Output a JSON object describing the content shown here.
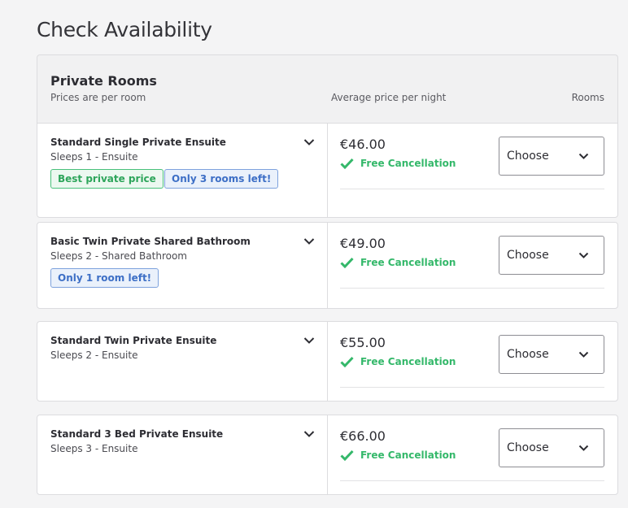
{
  "page": {
    "title": "Check Availability"
  },
  "header": {
    "title": "Private Rooms",
    "subtitle": "Prices are per room",
    "price_label": "Average price per night",
    "rooms_label": "Rooms"
  },
  "rooms": [
    {
      "name": "Standard Single Private Ensuite",
      "sleeps": "Sleeps 1 - Ensuite",
      "badges": [
        "Best private price",
        "Only 3 rooms left!"
      ],
      "price": "€46.00",
      "cancellation": "Free Cancellation",
      "select_value": "Choose"
    },
    {
      "name": "Basic Twin Private Shared Bathroom",
      "sleeps": "Sleeps 2 - Shared Bathroom",
      "badges": [
        "Only 1 room left!"
      ],
      "price": "€49.00",
      "cancellation": "Free Cancellation",
      "select_value": "Choose"
    },
    {
      "name": "Standard Twin Private Ensuite",
      "sleeps": "Sleeps 2 - Ensuite",
      "badges": [],
      "price": "€55.00",
      "cancellation": "Free Cancellation",
      "select_value": "Choose"
    },
    {
      "name": "Standard 3 Bed Private Ensuite",
      "sleeps": "Sleeps 3 - Ensuite",
      "badges": [],
      "price": "€66.00",
      "cancellation": "Free Cancellation",
      "select_value": "Choose"
    }
  ],
  "colors": {
    "accent_green": "#34b86a",
    "badge_blue": "#3d6fc6",
    "background": "#f4f4f5"
  },
  "icons": {
    "expand": "chevron-down-icon",
    "cancellation": "check-icon",
    "select": "chevron-down-icon"
  }
}
